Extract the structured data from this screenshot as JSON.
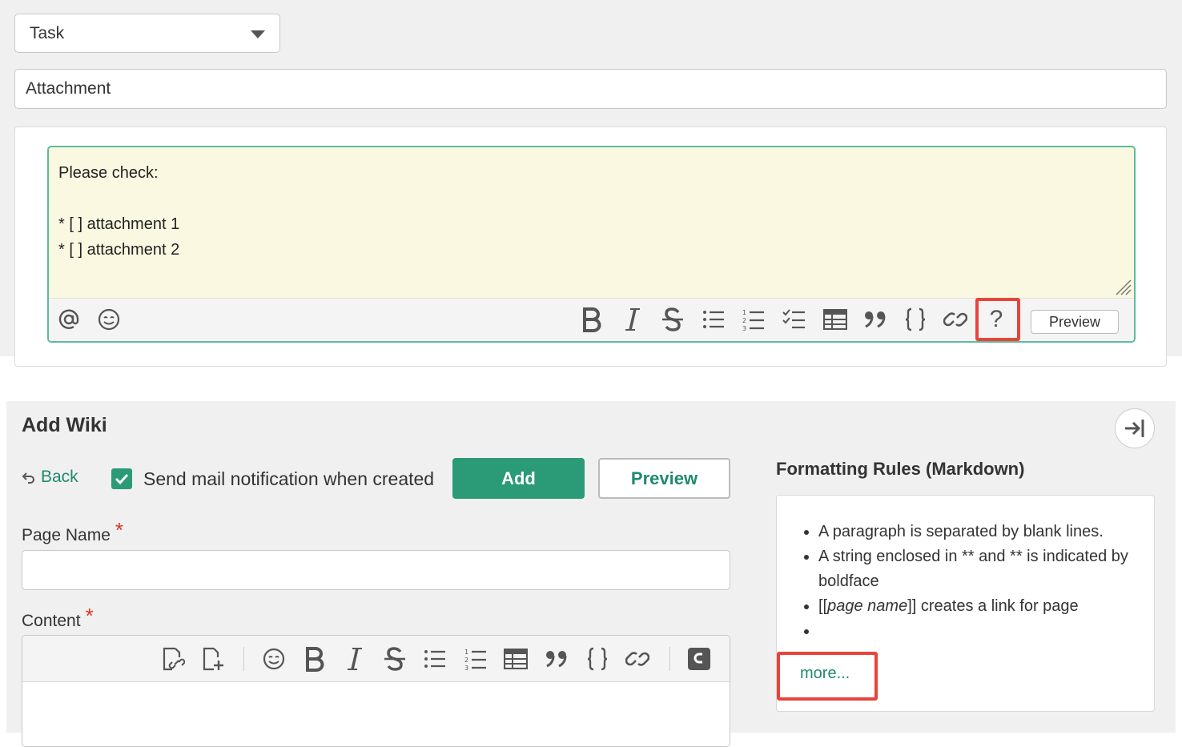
{
  "task_form": {
    "tracker_select": {
      "value": "Task"
    },
    "subject_input": {
      "value": "Attachment"
    },
    "description": {
      "lines": [
        "Please check:",
        "",
        "* [ ] attachment 1",
        "* [ ] attachment 2"
      ]
    },
    "toolbar": {
      "left_icons": [
        "at-mention-icon",
        "emoji-icon"
      ],
      "right_icons": [
        "bold-icon",
        "italic-icon",
        "strikethrough-icon",
        "bulleted-list-icon",
        "numbered-list-icon",
        "task-list-icon",
        "table-icon",
        "quote-icon",
        "code-icon",
        "link-icon",
        "help-icon"
      ],
      "help_label": "?",
      "preview_label": "Preview"
    }
  },
  "wiki_form": {
    "title": "Add Wiki",
    "back_label": "Back",
    "notify_checkbox": {
      "checked": true,
      "label": "Send mail notification when created"
    },
    "add_label": "Add",
    "preview_label": "Preview",
    "page_name_label": "Page Name",
    "content_label": "Content",
    "required_marker": "*",
    "content_toolbar_icons": [
      "attach-link-icon",
      "new-page-icon",
      "emoji-icon",
      "bold-icon",
      "italic-icon",
      "strikethrough-icon",
      "bulleted-list-icon",
      "numbered-list-icon",
      "table-icon",
      "quote-icon",
      "code-icon",
      "link-icon",
      "switch-editor-icon"
    ]
  },
  "formatting_rules": {
    "title": "Formatting Rules (Markdown)",
    "rule1": "A paragraph is separated by blank lines.",
    "rule2": "A string enclosed in ** and ** is indicated by boldface",
    "rule3_open": "[[",
    "rule3_italic": "page name",
    "rule3_close": "]] creates a link for page",
    "rule4": "",
    "more_label": "more..."
  },
  "colors": {
    "accent": "#2b9a77",
    "link": "#1f8a6d",
    "highlight_box": "#e8443a",
    "editor_background": "#faf8e1",
    "required": "#d9381e"
  }
}
